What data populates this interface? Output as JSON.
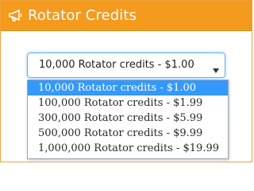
{
  "panel": {
    "title": "Rotator Credits",
    "icon": "megaphone-icon",
    "accent_color": "#f49a1c"
  },
  "select": {
    "selected_label": "10,000 Rotator credits - $1.00",
    "focus_color": "#66afe9"
  },
  "dropdown": {
    "highlight_color": "#3399ff",
    "options": [
      {
        "label": "10,000 Rotator credits - $1.00",
        "selected": true
      },
      {
        "label": "100,000 Rotator credits - $1.99",
        "selected": false
      },
      {
        "label": "300,000 Rotator credits - $5.99",
        "selected": false
      },
      {
        "label": "500,000 Rotator credits - $9.99",
        "selected": false
      },
      {
        "label": "1,000,000 Rotator credits - $19.99",
        "selected": false
      }
    ]
  }
}
